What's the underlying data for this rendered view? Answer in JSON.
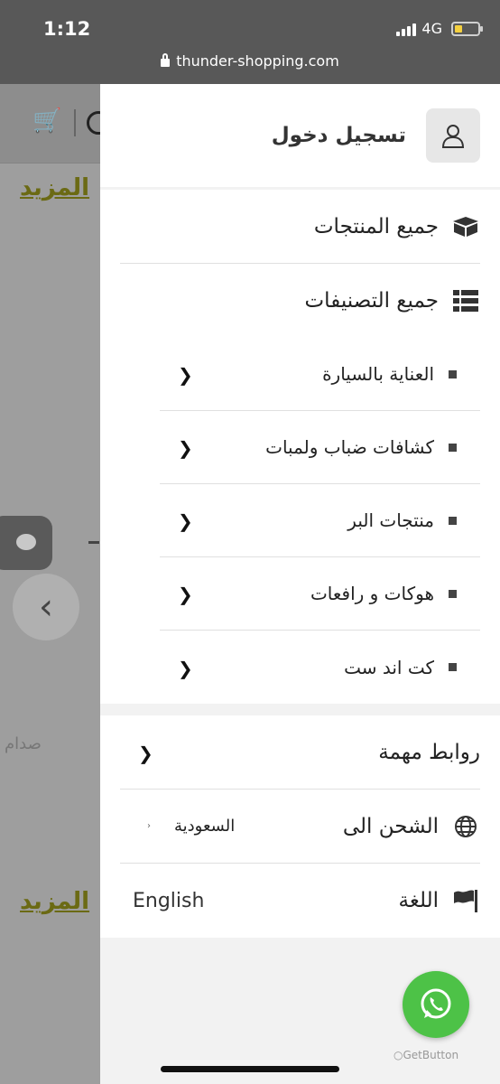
{
  "status_bar": {
    "time": "1:12",
    "network": "4G"
  },
  "browser": {
    "url": "thunder-shopping.com"
  },
  "background_page": {
    "more_link_1": "المزيد",
    "more_link_2": "المزيد",
    "partial_text": "صدام"
  },
  "drawer": {
    "login_label": "تسجيل دخول",
    "all_products": "جميع المنتجات",
    "all_categories": "جميع التصنيفات",
    "categories": [
      {
        "label": "العناية بالسيارة"
      },
      {
        "label": "كشافات ضباب ولمبات"
      },
      {
        "label": "منتجات البر"
      },
      {
        "label": "هوكات و رافعات"
      },
      {
        "label": "كت اند ست"
      }
    ],
    "important_links": "روابط مهمة",
    "shipping_label": "الشحن الى",
    "shipping_value": "السعودية",
    "language_label": "اللغة",
    "language_value": "English"
  },
  "widget": {
    "getbutton_label": "GetButton"
  },
  "colors": {
    "whatsapp": "#4dc247",
    "more_link": "#6b6a14",
    "status_bar": "#585858"
  }
}
